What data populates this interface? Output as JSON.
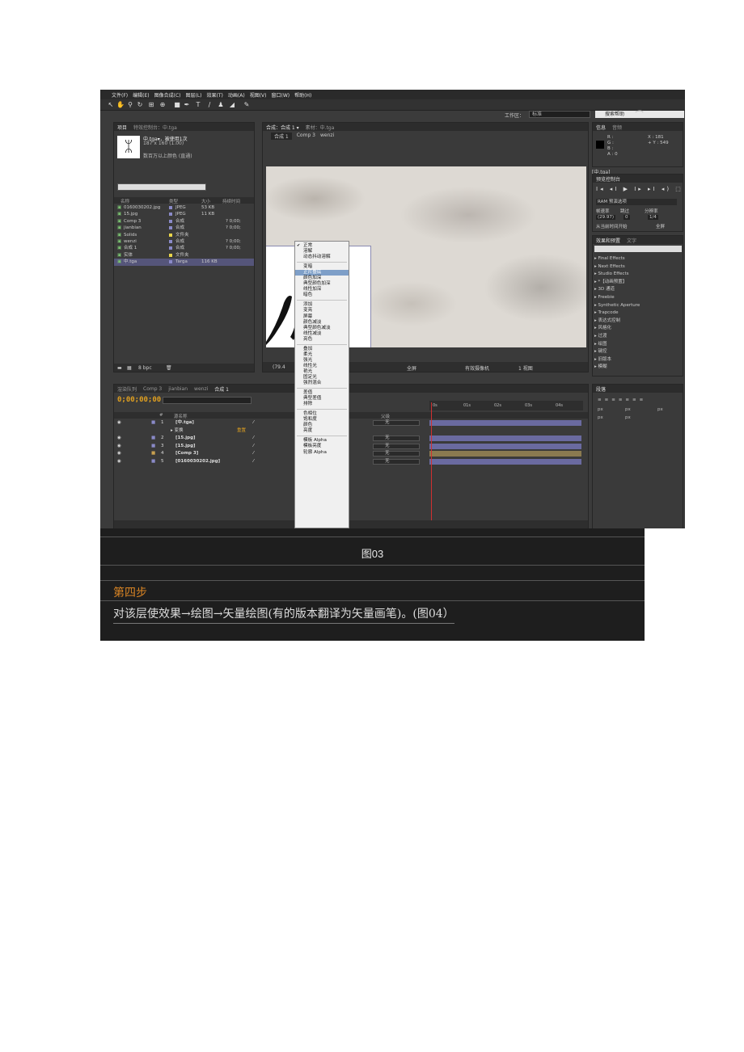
{
  "menu": [
    "文件(F)",
    "编辑(E)",
    "图像合成(C)",
    "图层(L)",
    "效果(T)",
    "动画(A)",
    "视图(V)",
    "窗口(W)",
    "帮助(H)"
  ],
  "toolbar": {
    "workspace_label": "工作区：",
    "workspace_value": "标准",
    "search_help": "搜索帮助"
  },
  "project": {
    "tabs": [
      "项目",
      "特效控制台：中.tga"
    ],
    "selected_name": "中.tga▾，被使用1次",
    "selected_dims": "187 x 160 (1.00)",
    "selected_color": "数百万以上颜色 (直通)",
    "thumb_glyph": "ᛯ",
    "columns": {
      "name": "名称",
      "type": "类型",
      "size": "大小",
      "duration": "持续时间"
    },
    "items": [
      {
        "name": "0160030202.jpg",
        "type": "JPEG",
        "size": "53 KB",
        "duration": "",
        "color": "#8a8ac8"
      },
      {
        "name": "15.jpg",
        "type": "JPEG",
        "size": "11 KB",
        "duration": "",
        "color": "#8a8ac8"
      },
      {
        "name": "Comp 3",
        "type": "合成",
        "size": "",
        "duration": "? 0;00;",
        "color": "#8a8ac8"
      },
      {
        "name": "jianbian",
        "type": "合成",
        "size": "",
        "duration": "? 0;00;",
        "color": "#8a8ac8"
      },
      {
        "name": "Solids",
        "type": "文件夹",
        "size": "",
        "duration": "",
        "color": "#e8d44a"
      },
      {
        "name": "wenzi",
        "type": "合成",
        "size": "",
        "duration": "? 0;00;",
        "color": "#8a8ac8"
      },
      {
        "name": "合成 1",
        "type": "合成",
        "size": "",
        "duration": "? 0;00;",
        "color": "#8a8ac8"
      },
      {
        "name": "实体",
        "type": "文件夹",
        "size": "",
        "duration": "",
        "color": "#e8d44a"
      },
      {
        "name": "中.tga",
        "type": "Targa",
        "size": "116 KB",
        "duration": "",
        "color": "#8a8ac8"
      }
    ],
    "footer_bpc": "8 bpc"
  },
  "comp": {
    "tabs": [
      "合成：合成 1 ▾",
      "素材：中.tga"
    ],
    "breadcrumb": [
      "合成 1",
      "Comp 3",
      "wenzi"
    ],
    "zoom": "(79.4",
    "footer_res": "全屏",
    "footer_camera": "有效摄像机",
    "footer_view": "1 视图"
  },
  "info": {
    "tabs": [
      "信息",
      "音频"
    ],
    "vals": "R :\nG :\nB :\nA : 0",
    "xy": "X : 181\n+ Y : 549",
    "file": "[中.tga]"
  },
  "preview": {
    "tab": "预览控制台",
    "controls": "I◂ ◂I ▶ I▸ ▸I ◂) ⬚",
    "ram": "RAM 预演选项",
    "fps_label": "帧速率",
    "skip_label": "跳过",
    "res_label": "分辨率",
    "fps": "(29.97)",
    "skip": "0",
    "res": "1/4",
    "from_current": "从当前时间开始",
    "fullscreen": "全屏"
  },
  "effects": {
    "tabs": [
      "效果和预置",
      "文字"
    ],
    "items": [
      "Final Effects",
      "Next Effects",
      "Studio Effects",
      "*【动画预置】",
      "3D 通道",
      "Freebie",
      "Synthetic Aperture",
      "Trapcode",
      "表达式控制",
      "风格化",
      "过渡",
      "绘图",
      "键控",
      "旧版本",
      "模糊"
    ]
  },
  "timeline": {
    "tabs": [
      "渲染队列",
      "Comp 3",
      "jianbian",
      "wenzi",
      "合成 1"
    ],
    "time": "0;00;00;00",
    "ruler": [
      "0s",
      "01s",
      "02s",
      "03s",
      "04s"
    ],
    "header": {
      "num": "#",
      "name": "源名称",
      "parent": "父级"
    },
    "layers": [
      {
        "num": "1",
        "name": "[中.tga]",
        "mode": "无",
        "sub": false,
        "color": "#8a8ac8"
      },
      {
        "num": "",
        "name": "变换",
        "mode": "",
        "sub": true,
        "reset": "重置",
        "color": ""
      },
      {
        "num": "2",
        "name": "[15.jpg]",
        "mode": "无",
        "sub": false,
        "color": "#8a8ac8"
      },
      {
        "num": "3",
        "name": "[15.jpg]",
        "mode": "无",
        "sub": false,
        "color": "#8a8ac8"
      },
      {
        "num": "4",
        "name": "[Comp 3]",
        "mode": "无",
        "sub": false,
        "color": "#c8a050"
      },
      {
        "num": "5",
        "name": "[0160030202.jpg]",
        "mode": "无",
        "sub": false,
        "color": "#8a8ac8"
      }
    ]
  },
  "paragraph": {
    "tab": "段落",
    "px": "px"
  },
  "blend_menu": {
    "groups": [
      [
        "正常",
        "溶解",
        "动态抖动溶解"
      ],
      [
        "变暗",
        "正片叠底",
        "颜色加深",
        "典型颜色加深",
        "线性加深",
        "暗色"
      ],
      [
        "添加",
        "变亮",
        "屏幕",
        "颜色减淡",
        "典型颜色减淡",
        "线性减淡",
        "亮色"
      ],
      [
        "叠加",
        "柔光",
        "强光",
        "线性光",
        "艳光",
        "固定光",
        "强烈混合"
      ],
      [
        "差值",
        "典型差值",
        "排除"
      ],
      [
        "色相位",
        "饱和度",
        "颜色",
        "亮度"
      ],
      [
        "模板 Alpha",
        "模板亮度",
        "轮廓 Alpha"
      ]
    ],
    "checked": "正常",
    "highlighted": "正片叠底"
  },
  "caption": "图03",
  "step": {
    "title": "第四步",
    "text": "对该层使效果→绘图→矢量绘图(有的版本翻译为矢量画笔)。(图04）"
  }
}
